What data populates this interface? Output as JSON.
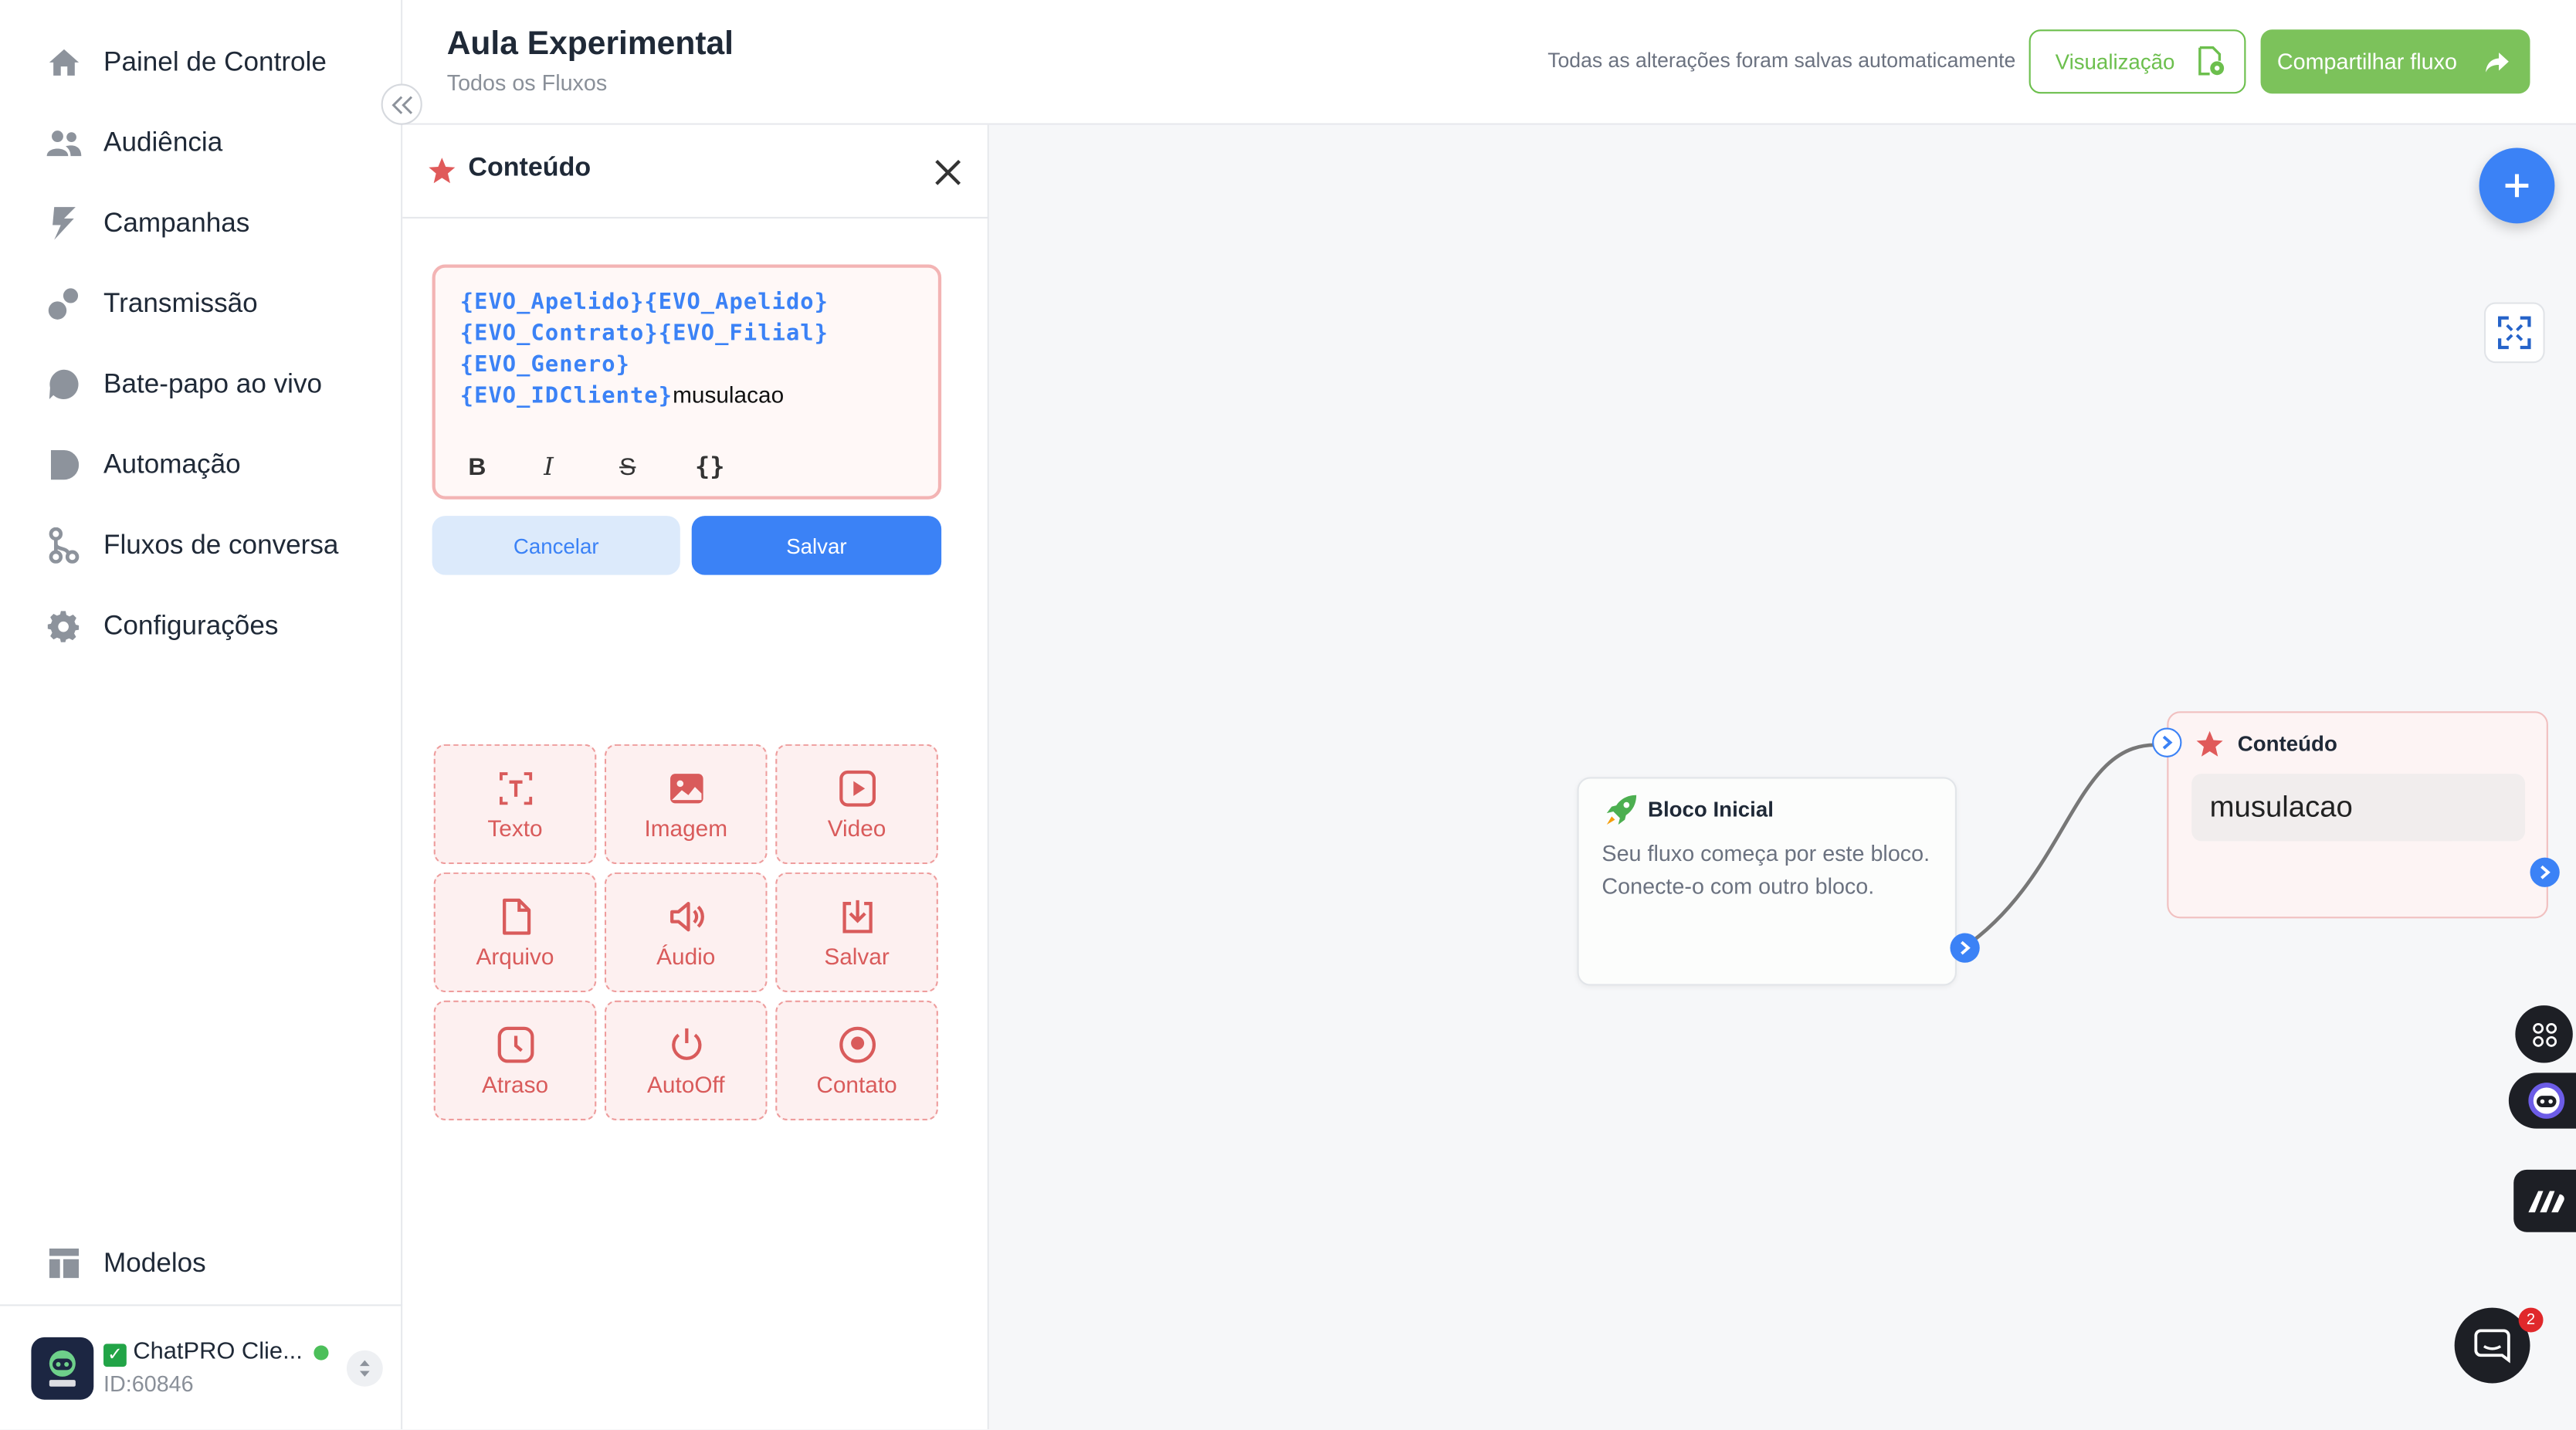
{
  "sidebar": {
    "items": [
      {
        "label": "Painel de Controle",
        "icon": "home-icon"
      },
      {
        "label": "Audiência",
        "icon": "users-icon"
      },
      {
        "label": "Campanhas",
        "icon": "campaign-icon"
      },
      {
        "label": "Transmissão",
        "icon": "broadcast-icon"
      },
      {
        "label": "Bate-papo ao vivo",
        "icon": "chat-bubble-icon"
      },
      {
        "label": "Automação",
        "icon": "automation-icon"
      },
      {
        "label": "Fluxos de conversa",
        "icon": "flow-icon"
      },
      {
        "label": "Configurações",
        "icon": "gear-icon"
      }
    ],
    "templates_label": "Modelos",
    "account": {
      "name": "ChatPRO Clie...",
      "id": "ID:60846",
      "status_color": "#4cbf5a"
    }
  },
  "header": {
    "title": "Aula Experimental",
    "breadcrumb": "Todos os Fluxos",
    "save_status": "Todas as alterações foram salvas automaticamente",
    "preview_label": "Visualização",
    "share_label": "Compartilhar fluxo"
  },
  "panel": {
    "title": "Conteúdo",
    "editor": {
      "variables": [
        "{EVO_Apelido}",
        "{EVO_Apelido}",
        "{EVO_Contrato}",
        "{EVO_Filial}",
        "{EVO_Genero}",
        "{EVO_IDCliente}"
      ],
      "text": "musulacao",
      "tools": [
        "B",
        "I",
        "S",
        "{}"
      ]
    },
    "cancel_label": "Cancelar",
    "save_label": "Salvar",
    "blocks": [
      {
        "label": "Texto",
        "icon": "text-icon"
      },
      {
        "label": "Imagem",
        "icon": "image-icon"
      },
      {
        "label": "Video",
        "icon": "video-icon"
      },
      {
        "label": "Arquivo",
        "icon": "file-icon"
      },
      {
        "label": "Áudio",
        "icon": "audio-icon"
      },
      {
        "label": "Salvar",
        "icon": "save-download-icon"
      },
      {
        "label": "Atraso",
        "icon": "delay-clock-icon"
      },
      {
        "label": "AutoOff",
        "icon": "power-icon"
      },
      {
        "label": "Contato",
        "icon": "contact-icon"
      }
    ]
  },
  "canvas": {
    "start_node": {
      "title": "Bloco Inicial",
      "description": "Seu fluxo começa por este bloco. Conecte-o com outro bloco."
    },
    "content_node": {
      "title": "Conteúdo",
      "text": "musulacao"
    }
  },
  "chat_badge": "2",
  "colors": {
    "accent": "#3b82f6",
    "green": "#7cc25b",
    "block_red": "#d95b5b",
    "sidebar_text": "#1f2937"
  }
}
